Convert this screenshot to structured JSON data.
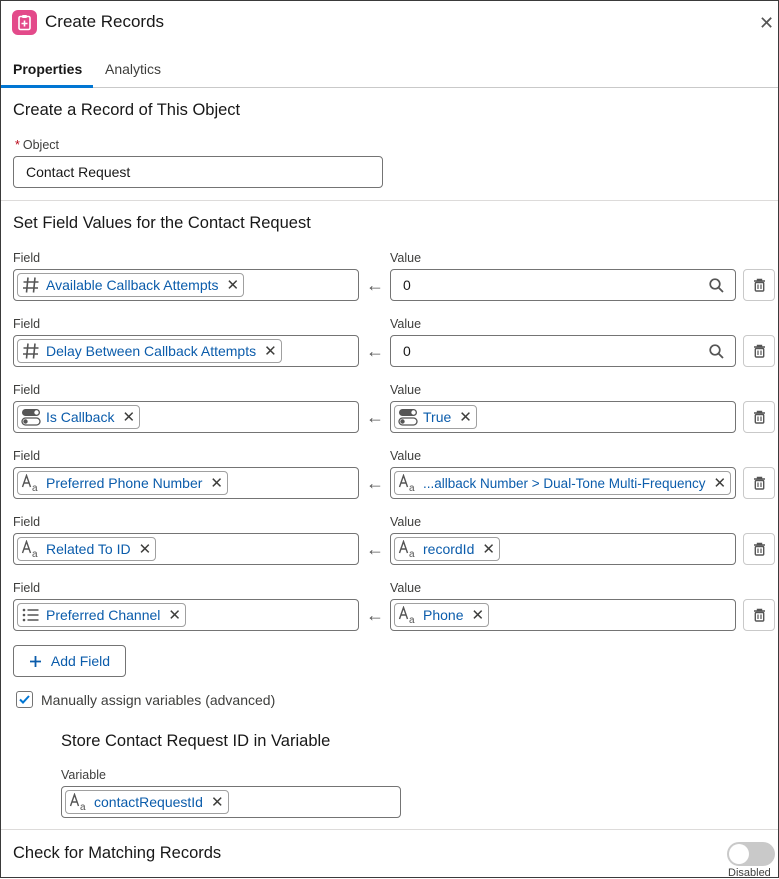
{
  "header": {
    "title": "Create Records",
    "icon": "create-record-icon"
  },
  "tabs": [
    {
      "label": "Properties",
      "active": true
    },
    {
      "label": "Analytics",
      "active": false
    }
  ],
  "object_section": {
    "title": "Create a Record of This Object",
    "object_label": "Object",
    "required_marker": "*",
    "object_value": "Contact Request"
  },
  "fields_section": {
    "title": "Set Field Values for the Contact Request",
    "field_label": "Field",
    "value_label": "Value",
    "rows": [
      {
        "field": "Available Callback Attempts",
        "field_icon": "number-icon",
        "value": "0",
        "value_type": "input"
      },
      {
        "field": "Delay Between Callback Attempts",
        "field_icon": "number-icon",
        "value": "0",
        "value_type": "input"
      },
      {
        "field": "Is Callback",
        "field_icon": "toggle-icon",
        "value": "True",
        "value_icon": "toggle-icon",
        "value_type": "pill"
      },
      {
        "field": "Preferred Phone Number",
        "field_icon": "text-icon",
        "value": "...allback Number > Dual-Tone Multi-Frequency",
        "value_icon": "text-icon",
        "value_type": "pill"
      },
      {
        "field": "Related To ID",
        "field_icon": "text-icon",
        "value": "recordId",
        "value_icon": "text-icon",
        "value_type": "pill"
      },
      {
        "field": "Preferred Channel",
        "field_icon": "picklist-icon",
        "value": "Phone",
        "value_icon": "text-icon",
        "value_type": "pill"
      }
    ],
    "add_field_label": "Add Field"
  },
  "manual_assign": {
    "label": "Manually assign variables (advanced)",
    "checked": true
  },
  "store_section": {
    "title": "Store Contact Request ID in Variable",
    "variable_label": "Variable",
    "variable_value": "contactRequestId"
  },
  "matching": {
    "title": "Check for Matching Records",
    "toggle_label": "Disabled",
    "enabled": false
  },
  "colors": {
    "accent": "#0176d3",
    "link": "#0b5cab",
    "icon_pink": "#e34a8a"
  }
}
